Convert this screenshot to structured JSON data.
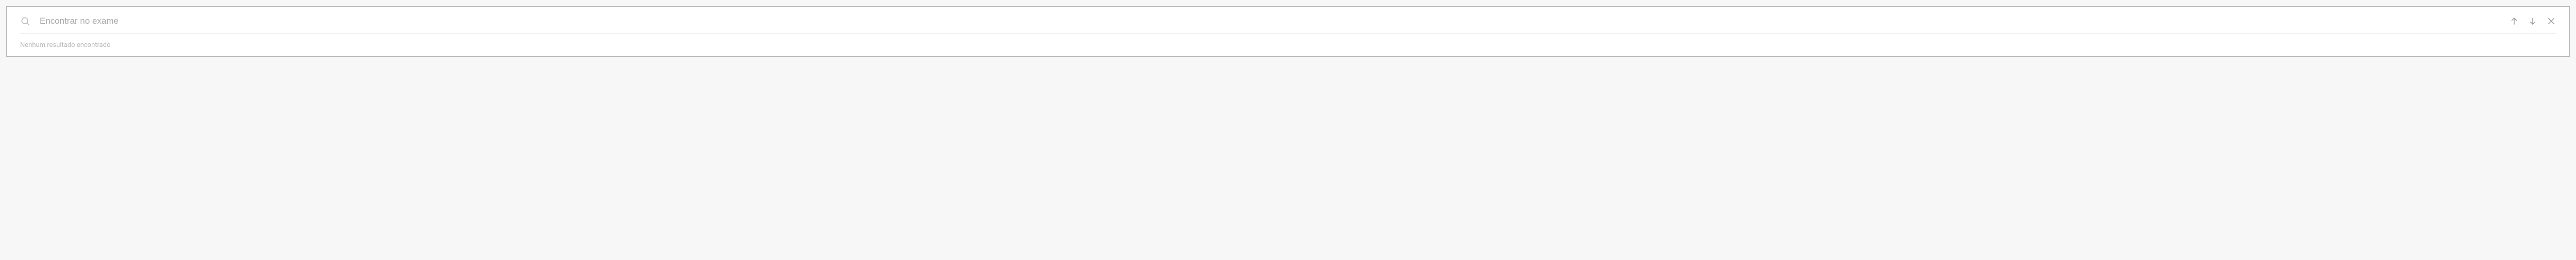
{
  "search": {
    "placeholder": "Encontrar no exame",
    "value": ""
  },
  "status": {
    "no_results": "Nenhum resultado encontrado"
  },
  "icons": {
    "search": "search-icon",
    "up": "arrow-up-icon",
    "down": "arrow-down-icon",
    "close": "close-icon"
  }
}
